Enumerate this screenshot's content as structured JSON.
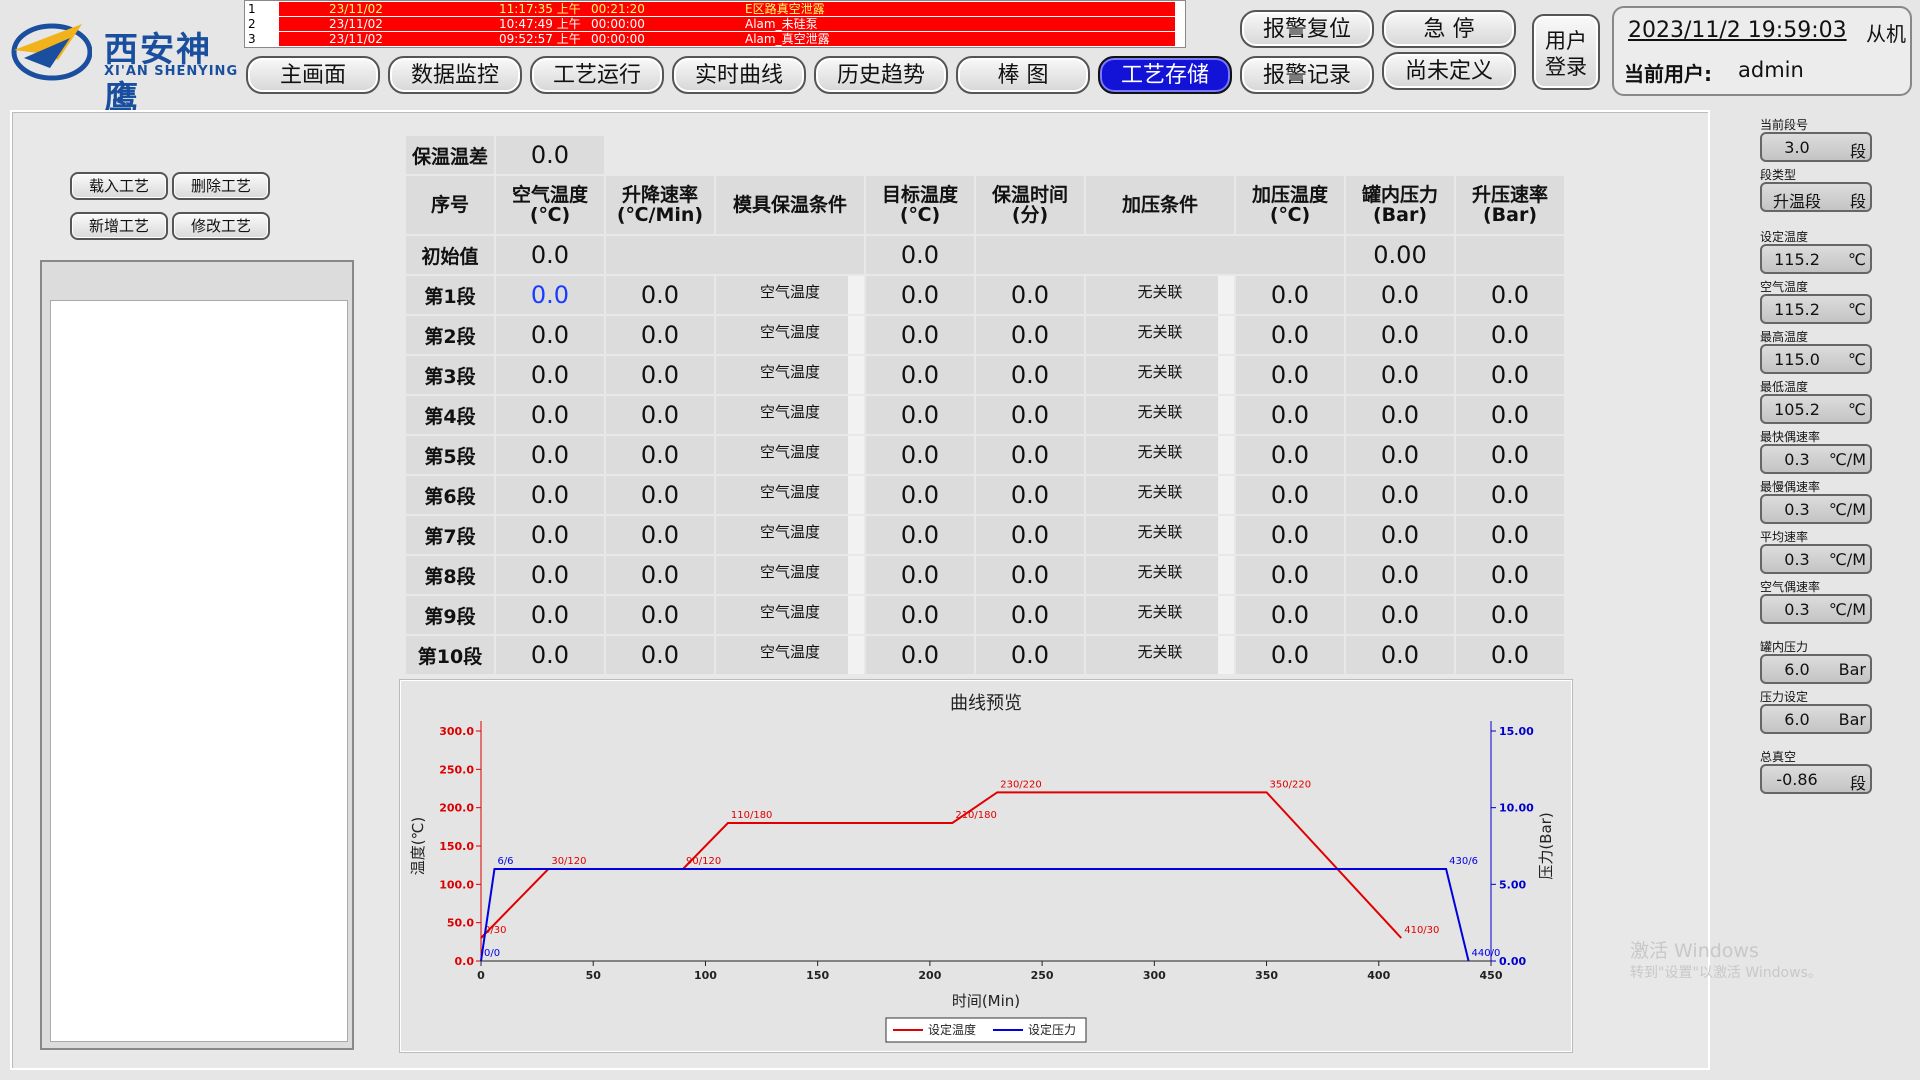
{
  "header": {
    "logo_cn": "西安神鹰",
    "logo_en": "XI'AN SHENYING",
    "datetime": "2023/11/2 19:59:03",
    "truncated_text": "从机",
    "current_user_label": "当前用户:",
    "current_user": "admin",
    "login_line1": "用户",
    "login_line2": "登录",
    "reset_alarm": "报警复位",
    "emergency_stop": "急  停",
    "alarm_record": "报警记录",
    "undefined": "尚未定义"
  },
  "alarms": [
    {
      "num": "1",
      "date": "23/11/02",
      "time": "11:17:35 上午",
      "dur": "00:21:20",
      "msg": "E区路真空泄露"
    },
    {
      "num": "2",
      "date": "23/11/02",
      "time": "10:47:49 上午",
      "dur": "00:00:00",
      "msg": "Alam_未硅泵"
    },
    {
      "num": "3",
      "date": "23/11/02",
      "time": "09:52:57 上午",
      "dur": "00:00:00",
      "msg": "Alam_真空泄露"
    }
  ],
  "nav": [
    "主画面",
    "数据监控",
    "工艺运行",
    "实时曲线",
    "历史趋势",
    "棒  图",
    "工艺存储"
  ],
  "left": {
    "load": "载入工艺",
    "delete": "删除工艺",
    "add": "新增工艺",
    "modify": "修改工艺"
  },
  "table": {
    "hold_label": "保温温差",
    "hold_value": "0.0",
    "headers": [
      "序号",
      "空气温度\n(℃)",
      "升降速率\n(℃/Min)",
      "模具保温条件",
      "目标温度\n(℃)",
      "保温时间\n(分)",
      "加压条件",
      "加压温度\n(℃)",
      "罐内压力\n(Bar)",
      "升压速率\n(Bar)"
    ],
    "init_label": "初始值",
    "init_air": "0.0",
    "init_target": "0.0",
    "init_pressure": "0.00",
    "rows": [
      {
        "label": "第1段",
        "air": "0.0",
        "rate": "0.0",
        "cond": "空气温度",
        "target": "0.0",
        "time": "0.0",
        "press_cond": "无关联",
        "press_temp": "0.0",
        "pressure": "0.0",
        "press_rate": "0.0"
      },
      {
        "label": "第2段",
        "air": "0.0",
        "rate": "0.0",
        "cond": "空气温度",
        "target": "0.0",
        "time": "0.0",
        "press_cond": "无关联",
        "press_temp": "0.0",
        "pressure": "0.0",
        "press_rate": "0.0"
      },
      {
        "label": "第3段",
        "air": "0.0",
        "rate": "0.0",
        "cond": "空气温度",
        "target": "0.0",
        "time": "0.0",
        "press_cond": "无关联",
        "press_temp": "0.0",
        "pressure": "0.0",
        "press_rate": "0.0"
      },
      {
        "label": "第4段",
        "air": "0.0",
        "rate": "0.0",
        "cond": "空气温度",
        "target": "0.0",
        "time": "0.0",
        "press_cond": "无关联",
        "press_temp": "0.0",
        "pressure": "0.0",
        "press_rate": "0.0"
      },
      {
        "label": "第5段",
        "air": "0.0",
        "rate": "0.0",
        "cond": "空气温度",
        "target": "0.0",
        "time": "0.0",
        "press_cond": "无关联",
        "press_temp": "0.0",
        "pressure": "0.0",
        "press_rate": "0.0"
      },
      {
        "label": "第6段",
        "air": "0.0",
        "rate": "0.0",
        "cond": "空气温度",
        "target": "0.0",
        "time": "0.0",
        "press_cond": "无关联",
        "press_temp": "0.0",
        "pressure": "0.0",
        "press_rate": "0.0"
      },
      {
        "label": "第7段",
        "air": "0.0",
        "rate": "0.0",
        "cond": "空气温度",
        "target": "0.0",
        "time": "0.0",
        "press_cond": "无关联",
        "press_temp": "0.0",
        "pressure": "0.0",
        "press_rate": "0.0"
      },
      {
        "label": "第8段",
        "air": "0.0",
        "rate": "0.0",
        "cond": "空气温度",
        "target": "0.0",
        "time": "0.0",
        "press_cond": "无关联",
        "press_temp": "0.0",
        "pressure": "0.0",
        "press_rate": "0.0"
      },
      {
        "label": "第9段",
        "air": "0.0",
        "rate": "0.0",
        "cond": "空气温度",
        "target": "0.0",
        "time": "0.0",
        "press_cond": "无关联",
        "press_temp": "0.0",
        "pressure": "0.0",
        "press_rate": "0.0"
      },
      {
        "label": "第10段",
        "air": "0.0",
        "rate": "0.0",
        "cond": "空气温度",
        "target": "0.0",
        "time": "0.0",
        "press_cond": "无关联",
        "press_temp": "0.0",
        "pressure": "0.0",
        "press_rate": "0.0"
      }
    ]
  },
  "right_panel": [
    {
      "label": "当前段号",
      "value": "3.0",
      "unit": "段"
    },
    {
      "label": "段类型",
      "value": "升温段",
      "unit": "段"
    },
    {
      "label": "设定温度",
      "value": "115.2",
      "unit": "℃"
    },
    {
      "label": "空气温度",
      "value": "115.2",
      "unit": "℃"
    },
    {
      "label": "最高温度",
      "value": "115.0",
      "unit": "℃"
    },
    {
      "label": "最低温度",
      "value": "105.2",
      "unit": "℃"
    },
    {
      "label": "最快偶速率",
      "value": "0.3",
      "unit": "℃/M"
    },
    {
      "label": "最慢偶速率",
      "value": "0.3",
      "unit": "℃/M"
    },
    {
      "label": "平均速率",
      "value": "0.3",
      "unit": "℃/M"
    },
    {
      "label": "空气偶速率",
      "value": "0.3",
      "unit": "℃/M"
    },
    {
      "label": "罐内压力",
      "value": "6.0",
      "unit": "Bar"
    },
    {
      "label": "压力设定",
      "value": "6.0",
      "unit": "Bar"
    },
    {
      "label": "总真空",
      "value": "-0.86",
      "unit": "段"
    }
  ],
  "watermark": {
    "line1": "激活 Windows",
    "line2": "转到\"设置\"以激活 Windows。"
  },
  "chart_data": {
    "type": "line",
    "title": "曲线预览",
    "xlabel": "时间(Min)",
    "ylabel": "温度(℃)",
    "y2label": "压力(Bar)",
    "xlim": [
      0,
      450
    ],
    "ylim": [
      0,
      300
    ],
    "y2lim": [
      0,
      15
    ],
    "xticks": [
      "0",
      "50",
      "100",
      "150",
      "200",
      "250",
      "300",
      "350",
      "400",
      "450"
    ],
    "yticks": [
      "0.0",
      "50.0",
      "100.0",
      "150.0",
      "200.0",
      "250.0",
      "300.0"
    ],
    "y2ticks": [
      "0.00",
      "5.00",
      "10.00",
      "15.00"
    ],
    "series": [
      {
        "name": "设定温度",
        "color": "#e00000",
        "axis": "left",
        "points": [
          [
            0,
            30
          ],
          [
            30,
            120
          ],
          [
            90,
            120
          ],
          [
            110,
            180
          ],
          [
            210,
            180
          ],
          [
            230,
            220
          ],
          [
            350,
            220
          ],
          [
            410,
            30
          ]
        ],
        "labels": [
          {
            "i": 0,
            "text": "0/30"
          },
          {
            "i": 1,
            "text": "30/120"
          },
          {
            "i": 2,
            "text": "90/120"
          },
          {
            "i": 3,
            "text": "110/180"
          },
          {
            "i": 4,
            "text": "210/180"
          },
          {
            "i": 5,
            "text": "230/220"
          },
          {
            "i": 6,
            "text": "350/220"
          },
          {
            "i": 7,
            "text": "410/30"
          }
        ]
      },
      {
        "name": "设定压力",
        "color": "#0000e0",
        "axis": "right",
        "points": [
          [
            0,
            0
          ],
          [
            6,
            6
          ],
          [
            430,
            6
          ],
          [
            440,
            0
          ]
        ],
        "labels": [
          {
            "i": 0,
            "text": "0/0"
          },
          {
            "i": 1,
            "text": "6/6"
          },
          {
            "i": 2,
            "text": "430/6"
          },
          {
            "i": 3,
            "text": "440/0"
          }
        ]
      }
    ],
    "legend": [
      "设定温度",
      "设定压力"
    ]
  }
}
